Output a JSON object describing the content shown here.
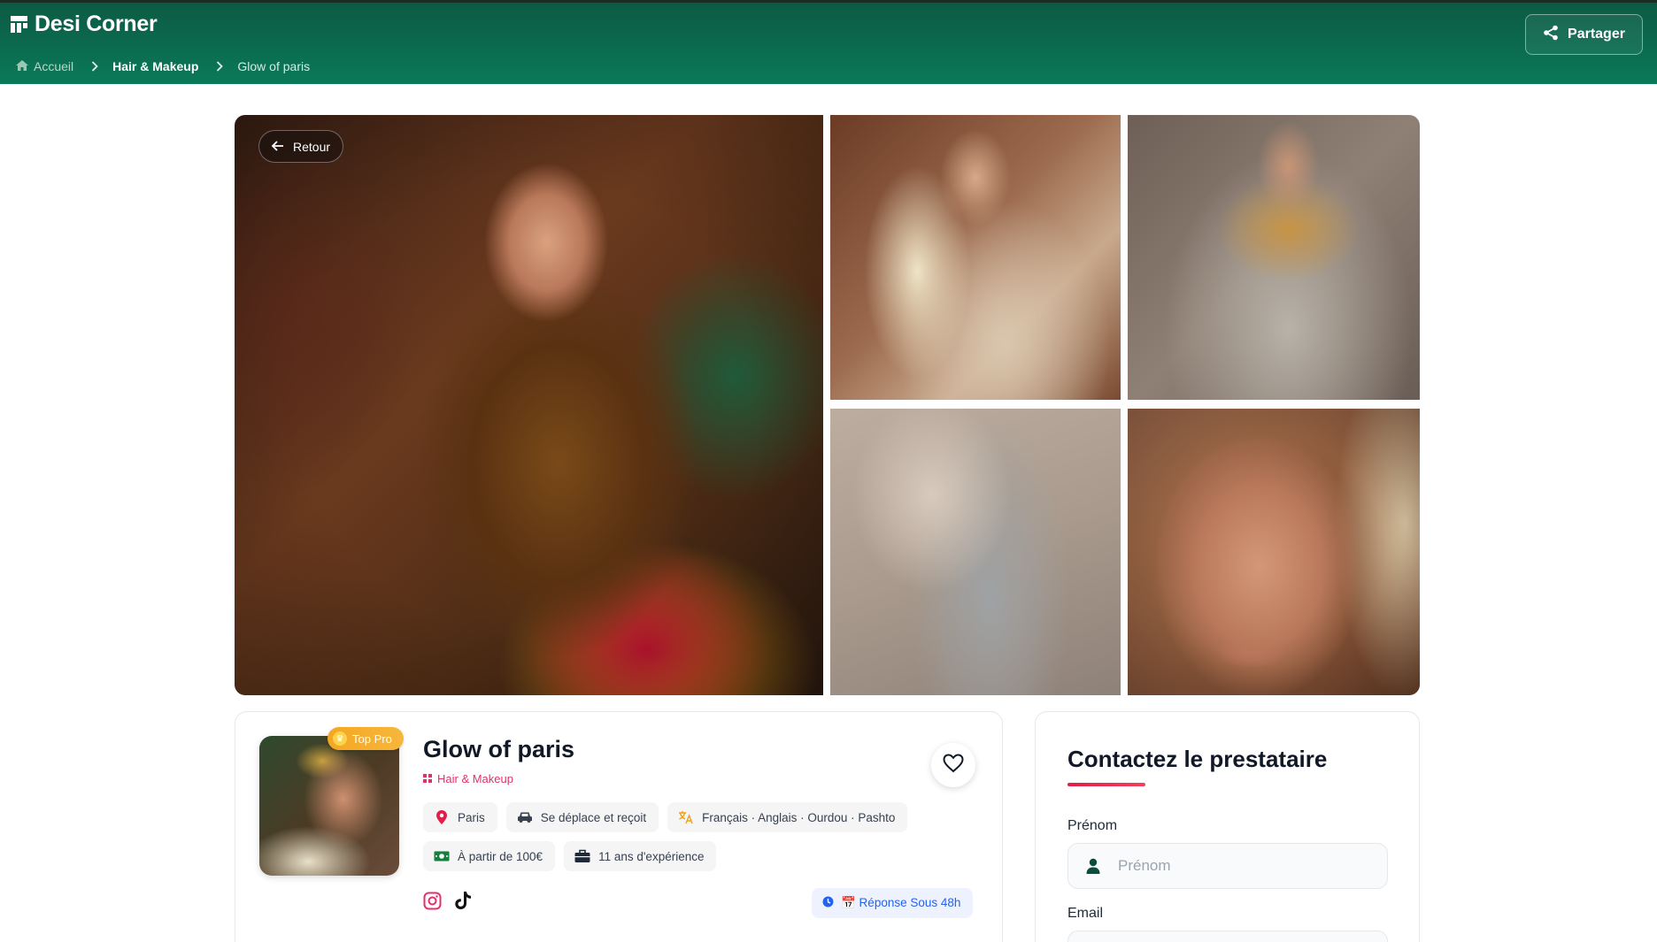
{
  "header": {
    "brand": "Desi Corner",
    "share_label": "Partager",
    "breadcrumb": {
      "home": "Accueil",
      "category": "Hair & Makeup",
      "current": "Glow of paris"
    }
  },
  "gallery": {
    "back_label": "Retour"
  },
  "profile": {
    "badge": "Top Pro",
    "name": "Glow of paris",
    "category": "Hair & Makeup",
    "chips": {
      "location": "Paris",
      "travel": "Se déplace et reçoit",
      "languages": "Français · Anglais · Ourdou · Pashto",
      "price": "À partir de 100€",
      "experience": "11 ans d'expérience"
    },
    "socials": [
      "instagram-icon",
      "tiktok-icon"
    ],
    "response": "📅 Réponse Sous 48h"
  },
  "contact": {
    "title": "Contactez le prestataire",
    "first_name_label": "Prénom",
    "first_name_placeholder": "Prénom",
    "email_label": "Email"
  },
  "colors": {
    "header_green": "#0b6b4f",
    "accent_pink": "#e1306c",
    "badge_gold": "#f5a623",
    "info_blue": "#2563eb"
  }
}
